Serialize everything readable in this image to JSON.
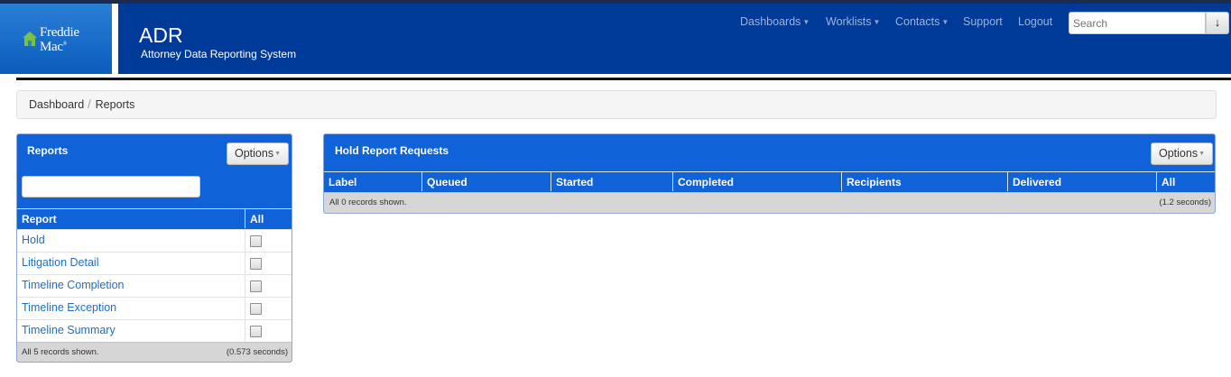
{
  "header": {
    "logo_line1": "Freddie",
    "logo_line2": "Mac",
    "logo_reg": "®",
    "app_title": "ADR",
    "app_subtitle": "Attorney Data Reporting System",
    "nav": [
      {
        "label": "Dashboards",
        "dropdown": true
      },
      {
        "label": "Worklists",
        "dropdown": true
      },
      {
        "label": "Contacts",
        "dropdown": true
      },
      {
        "label": "Support",
        "dropdown": false
      },
      {
        "label": "Logout",
        "dropdown": false
      }
    ],
    "search_placeholder": "Search",
    "search_button_icon": "down-arrow-icon",
    "search_button_glyph": "↓"
  },
  "breadcrumb": {
    "items": [
      "Dashboard",
      "Reports"
    ],
    "separator": "/"
  },
  "reports_panel": {
    "title": "Reports",
    "options_label": "Options",
    "filter_value": "",
    "columns": [
      "Report",
      "All"
    ],
    "rows": [
      {
        "label": "Hold",
        "checked": false
      },
      {
        "label": "Litigation Detail",
        "checked": false
      },
      {
        "label": "Timeline Completion",
        "checked": false
      },
      {
        "label": "Timeline Exception",
        "checked": false
      },
      {
        "label": "Timeline Summary",
        "checked": false
      }
    ],
    "footer_left": "All 5 records shown.",
    "footer_right": "(0.573 seconds)"
  },
  "hold_panel": {
    "title": "Hold Report Requests",
    "options_label": "Options",
    "columns": [
      "Label",
      "Queued",
      "Started",
      "Completed",
      "Recipients",
      "Delivered",
      "All"
    ],
    "footer_left": "All 0 records shown.",
    "footer_right": "(1.2 seconds)"
  },
  "colors": {
    "header_blue": "#003a99",
    "panel_blue": "#0f62d8",
    "link_blue": "#1f6fc4"
  }
}
